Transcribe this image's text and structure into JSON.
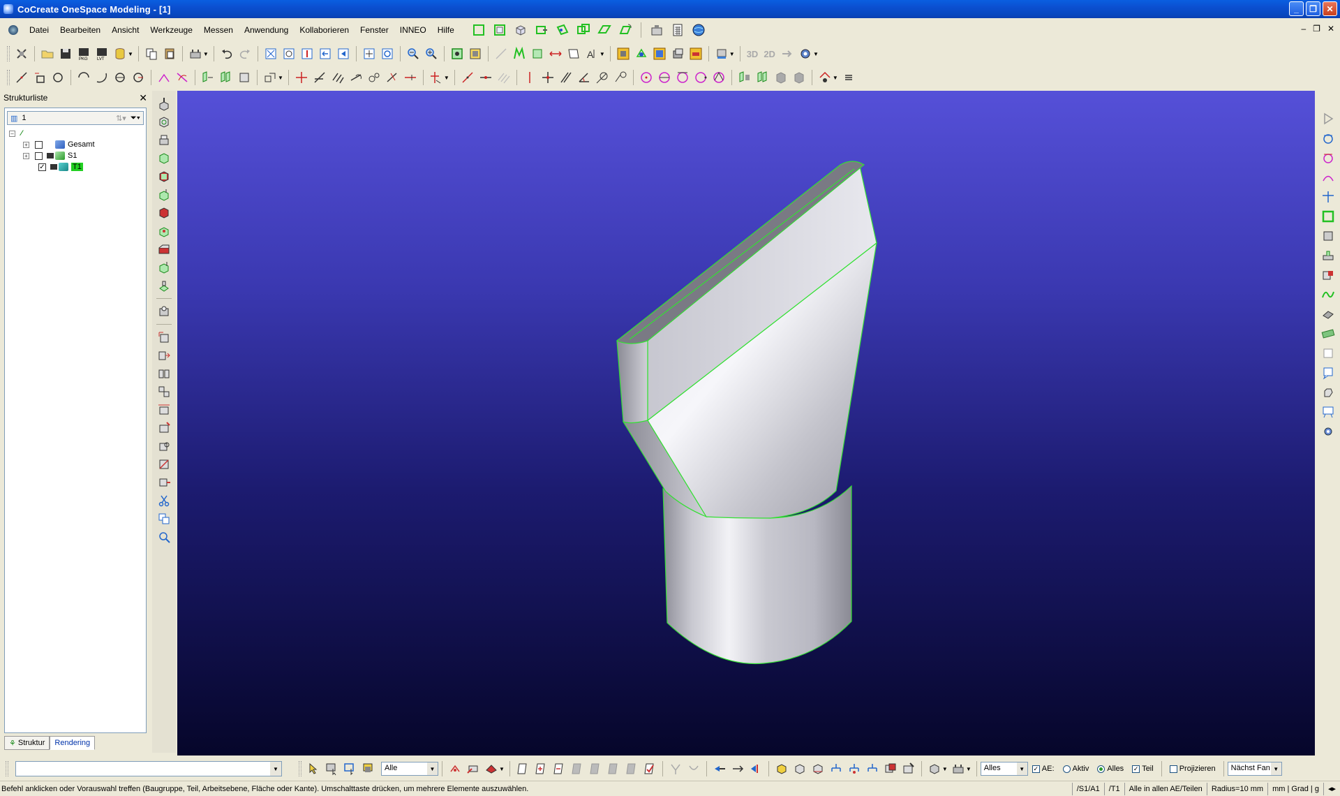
{
  "window": {
    "title": "CoCreate OneSpace Modeling - [1]"
  },
  "menu": {
    "items": [
      {
        "label": "Datei"
      },
      {
        "label": "Bearbeiten"
      },
      {
        "label": "Ansicht"
      },
      {
        "label": "Werkzeuge"
      },
      {
        "label": "Messen"
      },
      {
        "label": "Anwendung"
      },
      {
        "label": "Kollaborieren"
      },
      {
        "label": "Fenster"
      },
      {
        "label": "INNEO"
      },
      {
        "label": "Hilfe"
      }
    ]
  },
  "toolbar": {
    "label_3d": "3D",
    "label_2d": "2D"
  },
  "structure_panel": {
    "title": "Strukturliste",
    "combo_value": "1",
    "tree": [
      {
        "label": "Gesamt",
        "checked": false
      },
      {
        "label": "S1",
        "checked": false
      },
      {
        "label": "T1",
        "checked": true,
        "highlighted": true
      }
    ],
    "tabs": [
      {
        "label": "Struktur"
      },
      {
        "label": "Rendering"
      }
    ]
  },
  "bottom_toolbar": {
    "filter_select": "Alle",
    "scope_select": "Alles",
    "checkbox_ae": {
      "label": "AE:",
      "checked": true
    },
    "radio_aktiv": {
      "label": "Aktiv",
      "selected": false
    },
    "radio_alles": {
      "label": "Alles",
      "selected": true
    },
    "checkbox_teil": {
      "label": "Teil",
      "checked": true
    },
    "checkbox_projizieren": {
      "label": "Projizieren",
      "checked": false
    },
    "face_select": "Nächst Fan"
  },
  "status": {
    "message": "Befehl anklicken oder Vorauswahl treffen (Baugruppe, Teil, Arbeitsebene, Fläche oder Kante). Umschalttaste drücken, um mehrere Elemente auszuwählen.",
    "workplane": "/S1/A1",
    "part": "/T1",
    "scope": "Alle in allen AE/Teilen",
    "radius": "Radius=10 mm",
    "units": "mm | Grad | g"
  },
  "colors": {
    "accent_green": "#22d022",
    "viewport_top": "#5550d8",
    "viewport_bottom": "#06062a"
  }
}
